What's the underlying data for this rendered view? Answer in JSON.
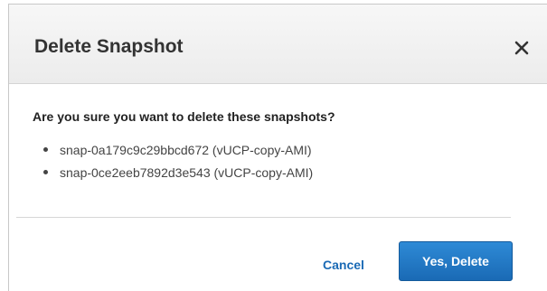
{
  "dialog": {
    "title": "Delete Snapshot",
    "close_icon": "close-icon",
    "question": "Are you sure you want to delete these snapshots?",
    "snapshots": [
      "snap-0a179c9c29bbcd672 (vUCP-copy-AMI)",
      "snap-0ce2eeb7892d3e543 (vUCP-copy-AMI)"
    ],
    "cancel_label": "Cancel",
    "confirm_label": "Yes, Delete"
  },
  "colors": {
    "primary_button": "#1a6ab5",
    "link": "#1a6ab5",
    "title_text": "#333333"
  }
}
